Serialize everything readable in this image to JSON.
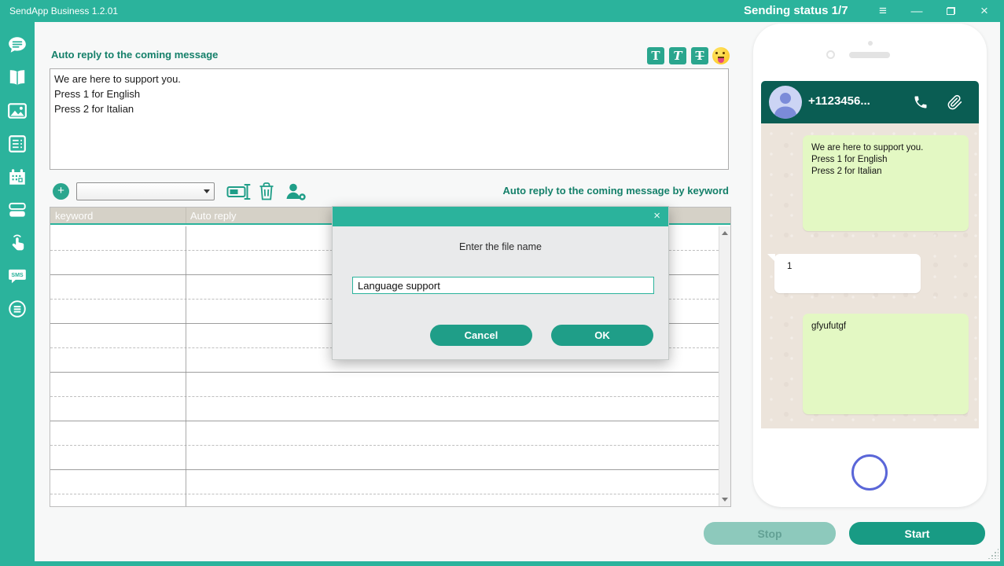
{
  "titlebar": {
    "app_title": "SendApp Business 1.2.01",
    "status": "Sending status 1/7",
    "controls": {
      "menu": "≡",
      "minimize": "—",
      "close": "×"
    }
  },
  "sidebar": {
    "items": [
      "chat",
      "book",
      "image",
      "list",
      "calendar",
      "bulk-messages",
      "tap",
      "sms",
      "menu-circle"
    ]
  },
  "main": {
    "auto_reply_label": "Auto reply to the coming message",
    "auto_reply_text": "We are here to support you.\nPress 1 for English\nPress 2 for Italian",
    "formatting": {
      "bold": "T",
      "italic": "T",
      "strikethrough": "T",
      "emoji": "winking-tongue-face"
    },
    "toolbar": {
      "add_label": "+",
      "template_select_value": ""
    },
    "keyword_label": "Auto reply to the coming message by keyword",
    "table": {
      "columns": [
        "keyword",
        "Auto reply"
      ],
      "row_count": 12,
      "rows": []
    }
  },
  "dialog": {
    "prompt": "Enter the file name",
    "input_value": "Language support",
    "cancel_label": "Cancel",
    "ok_label": "OK",
    "close": "×"
  },
  "phone": {
    "contact": "+1123456...",
    "messages": [
      {
        "side": "outgoing",
        "style": "green",
        "text": "We are here to support you.\nPress 1 for English\nPress 2 for Italian"
      },
      {
        "side": "incoming",
        "style": "white",
        "text": "1"
      },
      {
        "side": "outgoing",
        "style": "green",
        "text": "gfyufutgf"
      }
    ]
  },
  "footer": {
    "stop_label": "Stop",
    "start_label": "Start"
  },
  "colors": {
    "accent_teal": "#2bb39c",
    "button_teal": "#1f9e88",
    "label_green": "#15806a",
    "whatsapp_header": "#0a5d53",
    "bubble_green": "#e3f8c3",
    "chat_background": "#ece4db",
    "table_header": "#d5d1c7",
    "disabled_button": "#8dc9bc",
    "home_ring_blue": "#5a66d8"
  }
}
